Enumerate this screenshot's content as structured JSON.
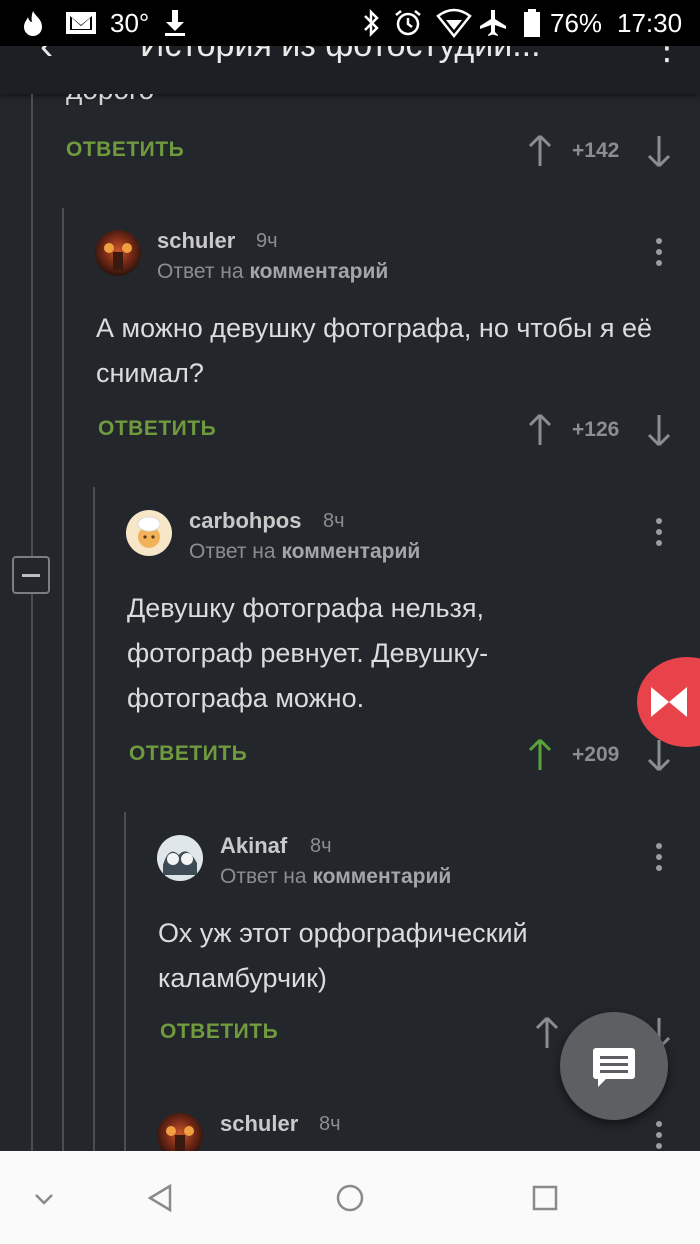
{
  "status_bar": {
    "temperature": "30°",
    "battery": "76%",
    "time": "17:30",
    "icons": [
      "fire-icon",
      "mail-icon",
      "download-icon",
      "bluetooth-icon",
      "alarm-icon",
      "wifi-icon",
      "airplane-icon",
      "battery-icon"
    ]
  },
  "app_bar": {
    "title": "История из фотостудии...",
    "back_icon": "arrow-left-icon",
    "menu_icon": "more-vertical-icon"
  },
  "previous_comment": {
    "text_tail": "дорого",
    "reply_label": "ОТВЕТИТЬ",
    "score": "+142"
  },
  "comments": [
    {
      "user": "schuler",
      "time": "9ч",
      "reply_prefix": "Ответ на",
      "reply_target": "комментарий",
      "text": "А можно девушку фотографа, но чтобы я её снимал?",
      "reply_label": "ОТВЕТИТЬ",
      "score": "+126"
    },
    {
      "user": "carbohpos",
      "time": "8ч",
      "reply_prefix": "Ответ на",
      "reply_target": "комментарий",
      "text": "Девушку фотографа нельзя, фотограф ревнует. Девушку-фотографа можно.",
      "reply_label": "ОТВЕТИТЬ",
      "score": "+209",
      "upvoted": true
    },
    {
      "user": "Akinaf",
      "time": "8ч",
      "reply_prefix": "Ответ на",
      "reply_target": "комментарий",
      "text": "Ох уж этот орфографический каламбурчик)",
      "reply_label": "ОТВЕТИТЬ"
    },
    {
      "user": "schuler",
      "time": "8ч"
    }
  ],
  "colors": {
    "background": "#23262b",
    "accent_green": "#6f9a3e",
    "upvote_active": "#5aa33a",
    "fab": "#5d5f63",
    "float_button": "#e8424b"
  },
  "nav_bar": {
    "icons": [
      "chevron-down-icon",
      "back-triangle-icon",
      "home-circle-icon",
      "recents-square-icon"
    ]
  }
}
